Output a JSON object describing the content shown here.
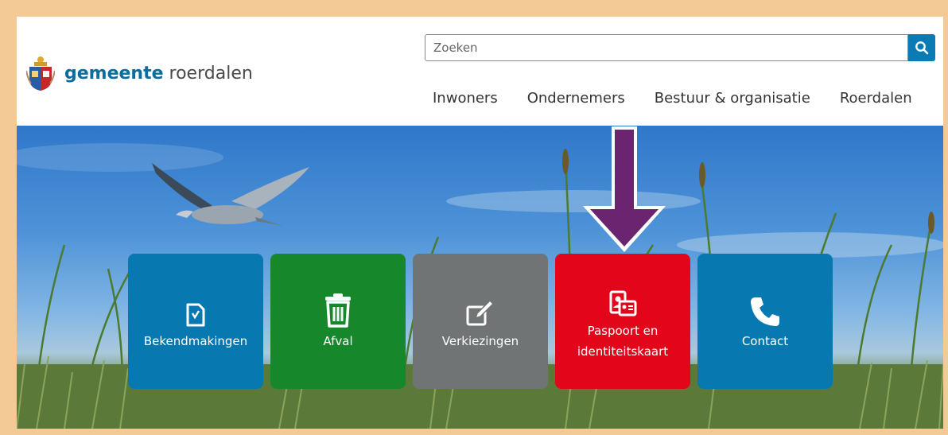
{
  "header": {
    "logo_bold": "gemeente",
    "logo_regular": " roerdalen"
  },
  "search": {
    "placeholder": "Zoeken"
  },
  "nav": {
    "items": [
      "Inwoners",
      "Ondernemers",
      "Bestuur & organisatie",
      "Roerdalen"
    ]
  },
  "tiles": [
    {
      "label": "Bekendmakingen",
      "icon": "document-check-icon",
      "color": "#0879b0"
    },
    {
      "label": "Afval",
      "icon": "trash-icon",
      "color": "#16872b"
    },
    {
      "label": "Verkiezingen",
      "icon": "pencil-ballot-icon",
      "color": "#707474"
    },
    {
      "label_line1": "Paspoort en",
      "label_line2": "identiteitskaart",
      "icon": "id-card-icon",
      "color": "#e3061b"
    },
    {
      "label": "Contact",
      "icon": "phone-icon",
      "color": "#0879b0"
    }
  ],
  "annotation": {
    "arrow_color": "#6b2470"
  }
}
